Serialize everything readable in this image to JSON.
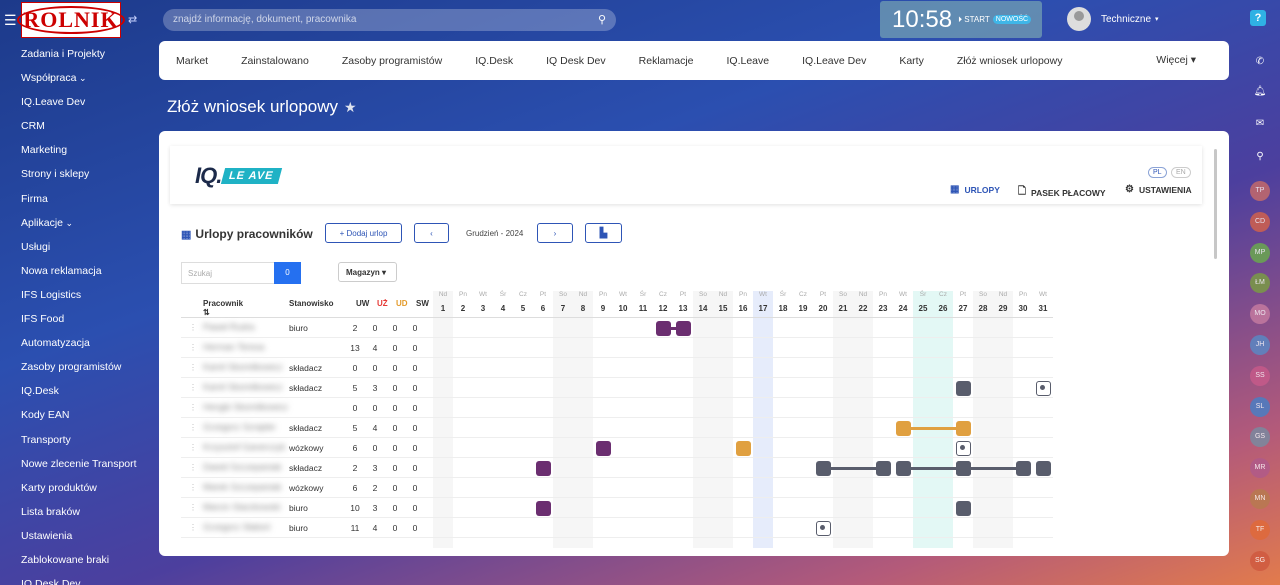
{
  "topbar": {
    "logo_text": "ROLNIK",
    "search_placeholder": "znajdź informację, dokument, pracownika",
    "clock_time": "10:58",
    "clock_start": "START",
    "clock_badge": "NOWOŚĆ",
    "user_name": "Techniczne",
    "help": "?"
  },
  "sidebar": {
    "items": [
      "Zadania i Projekty",
      "Współpraca",
      "IQ.Leave Dev",
      "CRM",
      "Marketing",
      "Strony i sklepy",
      "Firma",
      "Aplikacje",
      "Usługi",
      "Nowa reklamacja",
      "IFS Logistics",
      "IFS Food",
      "Automatyzacja",
      "Zasoby programistów",
      "IQ.Desk",
      "Kody EAN",
      "Transporty",
      "Nowe zlecenie Transport",
      "Karty produktów",
      "Lista braków",
      "Ustawienia",
      "Zablokowane braki",
      "IQ.Desk Dev"
    ]
  },
  "rail": {
    "avatars": [
      "TP",
      "CD",
      "MP",
      "ŁM",
      "MO",
      "JH",
      "SS",
      "SL",
      "GS",
      "MR",
      "MN",
      "TF",
      "SG"
    ]
  },
  "menubar": {
    "items": [
      "Market",
      "Zainstalowano",
      "Zasoby programistów",
      "IQ.Desk",
      "IQ Desk Dev",
      "Reklamacje",
      "IQ.Leave",
      "IQ.Leave Dev",
      "Karty",
      "Złóż wniosek urlopowy"
    ],
    "more": "Więcej"
  },
  "page": {
    "title": "Złóż wniosek urlopowy"
  },
  "app": {
    "logo_iq": "IQ.",
    "logo_leave": "LE AVE",
    "lang_pl": "PL",
    "lang_en": "EN",
    "nav": {
      "urlopy": "URLOPY",
      "pasek": "PASEK PŁACOWY",
      "ustawienia": "USTAWIENIA"
    },
    "section_title": "Urlopy pracowników",
    "add_button": "Dodaj urlop",
    "month_label": "Grudzień - 2024",
    "search_placeholder": "Szukaj",
    "search_count": "0",
    "filter": "Magazyn"
  },
  "table": {
    "headers": {
      "employee": "Pracownik",
      "position": "Stanowisko",
      "uw": "UW",
      "uz": "UŻ",
      "ud": "UD",
      "sw": "SW"
    },
    "day_names": [
      "Nd",
      "Pn",
      "Wt",
      "Śr",
      "Cz",
      "Pt",
      "So",
      "Nd",
      "Pn",
      "Wt",
      "Śr",
      "Cz",
      "Pt",
      "So",
      "Nd",
      "Pn",
      "Wt",
      "Śr",
      "Cz",
      "Pt",
      "So",
      "Nd",
      "Pn",
      "Wt",
      "Śr",
      "Cz",
      "Pt",
      "So",
      "Nd",
      "Pn",
      "Wt"
    ],
    "day_numbers": [
      "1",
      "2",
      "3",
      "4",
      "5",
      "6",
      "7",
      "8",
      "9",
      "10",
      "11",
      "12",
      "13",
      "14",
      "15",
      "16",
      "17",
      "18",
      "19",
      "20",
      "21",
      "22",
      "23",
      "24",
      "25",
      "26",
      "27",
      "28",
      "29",
      "30",
      "31"
    ],
    "rows": [
      {
        "name": "Paweł Rudra",
        "position": "biuro",
        "uw": "2",
        "uz": "0",
        "ud": "0",
        "sw": "0"
      },
      {
        "name": "Herman Teresa",
        "position": "",
        "uw": "13",
        "uz": "4",
        "ud": "0",
        "sw": "0"
      },
      {
        "name": "Kamil Skomitkowicz",
        "position": "składacz",
        "uw": "0",
        "uz": "0",
        "ud": "0",
        "sw": "0"
      },
      {
        "name": "Kamil Skomitkowicz",
        "position": "składacz",
        "uw": "5",
        "uz": "3",
        "ud": "0",
        "sw": "0"
      },
      {
        "name": "Hengki Skomitkowicz",
        "position": "",
        "uw": "0",
        "uz": "0",
        "ud": "0",
        "sw": "0"
      },
      {
        "name": "Grzegorz Szrajder",
        "position": "składacz",
        "uw": "5",
        "uz": "4",
        "ud": "0",
        "sw": "0"
      },
      {
        "name": "Krzysztof Ganerczyk",
        "position": "wózkowy",
        "uw": "6",
        "uz": "0",
        "ud": "0",
        "sw": "0"
      },
      {
        "name": "Dawid Szczepaniak",
        "position": "składacz",
        "uw": "2",
        "uz": "3",
        "ud": "0",
        "sw": "0"
      },
      {
        "name": "Marek Szczepaniak",
        "position": "wózkowy",
        "uw": "6",
        "uz": "2",
        "ud": "0",
        "sw": "0"
      },
      {
        "name": "Marcin Starzkowski",
        "position": "biuro",
        "uw": "10",
        "uz": "3",
        "ud": "0",
        "sw": "0"
      },
      {
        "name": "Grzegorz Słaboń",
        "position": "biuro",
        "uw": "11",
        "uz": "4",
        "ud": "0",
        "sw": "0"
      }
    ],
    "marks": [
      {
        "row": 0,
        "days": [
          12,
          13
        ],
        "color": "#6b2e70",
        "style": "solid",
        "connect": true
      },
      {
        "row": 3,
        "days": [
          27
        ],
        "color": "#595d6c",
        "style": "solid"
      },
      {
        "row": 3,
        "days": [
          31
        ],
        "color": "#595d6c",
        "style": "ring"
      },
      {
        "row": 5,
        "days": [
          24,
          27
        ],
        "color": "#e0a040",
        "style": "solid",
        "connect": true
      },
      {
        "row": 6,
        "days": [
          9
        ],
        "color": "#6b2e70",
        "style": "solid"
      },
      {
        "row": 6,
        "days": [
          16
        ],
        "color": "#e0a040",
        "style": "solid"
      },
      {
        "row": 6,
        "days": [
          27
        ],
        "color": "#595d6c",
        "style": "ring"
      },
      {
        "row": 7,
        "days": [
          6
        ],
        "color": "#6b2e70",
        "style": "solid"
      },
      {
        "row": 7,
        "days": [
          20,
          23
        ],
        "color": "#595d6c",
        "style": "solid",
        "connect": true
      },
      {
        "row": 7,
        "days": [
          24,
          27
        ],
        "color": "#595d6c",
        "style": "solid",
        "connect": true
      },
      {
        "row": 7,
        "days": [
          27,
          30
        ],
        "color": "#595d6c",
        "style": "solid",
        "connect": true
      },
      {
        "row": 7,
        "days": [
          31
        ],
        "color": "#595d6c",
        "style": "solid"
      },
      {
        "row": 9,
        "days": [
          6
        ],
        "color": "#6b2e70",
        "style": "solid"
      },
      {
        "row": 9,
        "days": [
          27
        ],
        "color": "#595d6c",
        "style": "solid"
      },
      {
        "row": 10,
        "days": [
          20
        ],
        "color": "#595d6c",
        "style": "ring"
      }
    ],
    "highlight_days": {
      "today": 17,
      "range": [
        25,
        26
      ]
    },
    "weekend_days": [
      1,
      7,
      8,
      14,
      15,
      21,
      22,
      28,
      29
    ]
  }
}
